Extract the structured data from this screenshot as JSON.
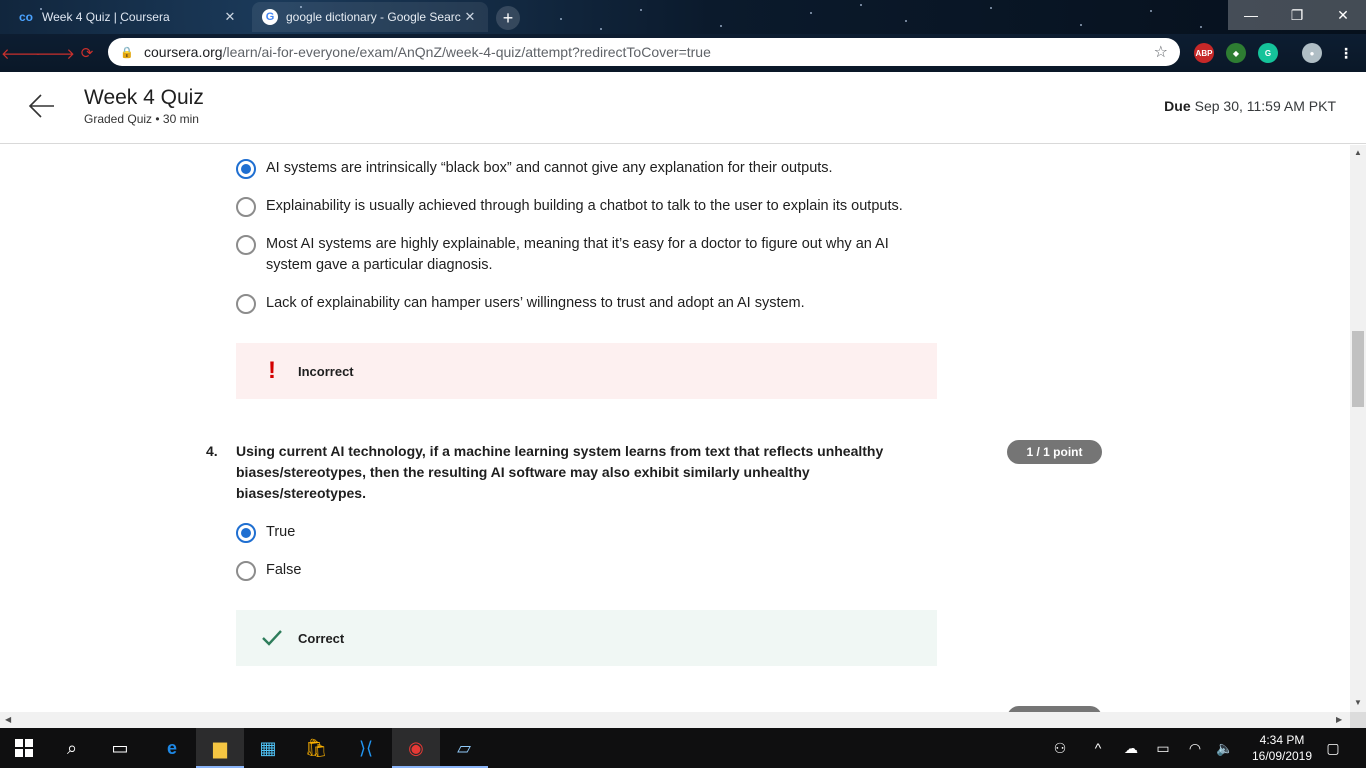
{
  "browser": {
    "tabs": [
      {
        "title": "Week 4 Quiz | Coursera",
        "active": false
      },
      {
        "title": "google dictionary - Google Searc",
        "active": true
      }
    ],
    "url_host": "coursera.org",
    "url_path": "/learn/ai-for-everyone/exam/AnQnZ/week-4-quiz/attempt?redirectToCover=true"
  },
  "header": {
    "title": "Week 4 Quiz",
    "subtitle": "Graded Quiz • 30 min",
    "due_label": "Due",
    "due_value": "Sep 30, 11:59 AM PKT"
  },
  "question3": {
    "options": [
      "AI systems are intrinsically “black box” and cannot give any explanation for their outputs.",
      "Explainability is usually achieved through building a chatbot to talk to the user to explain its outputs.",
      "Most AI systems are highly explainable, meaning that it’s easy for a doctor to figure out why an AI system gave a particular diagnosis.",
      "Lack of explainability can hamper users’ willingness to trust and adopt an AI system."
    ],
    "selected_index": 0,
    "feedback": "Incorrect"
  },
  "question4": {
    "number": "4.",
    "text": "Using current AI technology, if a machine learning system learns from text that reflects unhealthy biases/stereotypes, then the resulting AI software may also exhibit similarly unhealthy biases/stereotypes.",
    "points": "1 / 1 point",
    "options": [
      "True",
      "False"
    ],
    "selected_index": 0,
    "feedback": "Correct"
  },
  "taskbar": {
    "time": "4:34 PM",
    "date": "16/09/2019"
  },
  "colors": {
    "radio_selected": "#1f6fd1",
    "incorrect_bg": "#fdf0f0",
    "correct_bg": "#f0f7f4",
    "incorrect_icon": "#d30000",
    "correct_icon": "#2e7d5b",
    "points_badge": "#757575"
  }
}
